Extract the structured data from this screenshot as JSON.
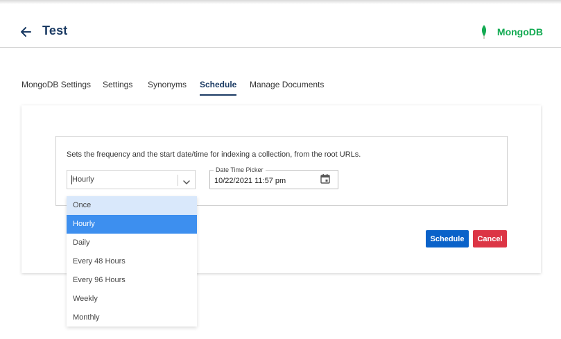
{
  "header": {
    "title": "Test",
    "brand": "MongoDB",
    "brand_color": "#13aa52",
    "title_color": "#1a3a63"
  },
  "tabs": [
    {
      "label": "MongoDB Settings",
      "active": false
    },
    {
      "label": "Settings",
      "active": false
    },
    {
      "label": "Synonyms",
      "active": false
    },
    {
      "label": "Schedule",
      "active": true
    },
    {
      "label": "Manage Documents",
      "active": false
    }
  ],
  "schedule": {
    "description": "Sets the frequency and the start date/time for indexing a collection, from the root URLs.",
    "frequency_value": "Hourly",
    "frequency_options": [
      "Once",
      "Hourly",
      "Daily",
      "Every 48 Hours",
      "Every 96 Hours",
      "Weekly",
      "Monthly"
    ],
    "hovered_option": "Once",
    "datetime_label": "Date Time Picker",
    "datetime_value": "10/22/2021 11:57 pm",
    "schedule_button": "Schedule",
    "cancel_button": "Cancel",
    "primary_color": "#0a62c9",
    "danger_color": "#dc3545"
  }
}
